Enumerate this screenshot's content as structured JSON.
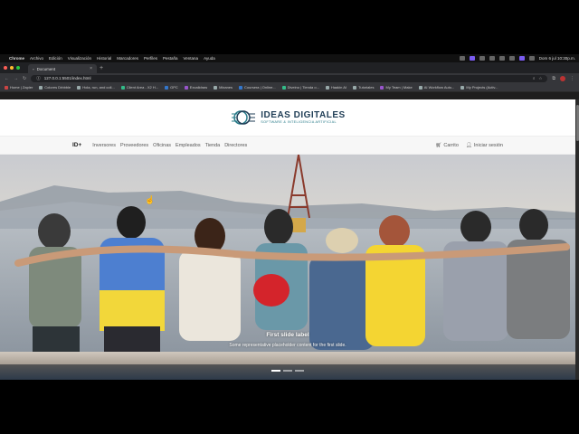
{
  "menubar": {
    "app": "Chrome",
    "items": [
      "Archivo",
      "Edición",
      "Visualización",
      "Historial",
      "Marcadores",
      "Perfiles",
      "Pestaña",
      "Ventana",
      "Ayuda"
    ],
    "clock": "Dom 6 jul 10:30p.m."
  },
  "browser": {
    "tab_title": "Document",
    "url": "127.0.0.1:5501/index.html",
    "bookmarks": [
      {
        "label": "Home | Zapier",
        "icon": "red"
      },
      {
        "label": "Colores Drbbble",
        "icon": "folder"
      },
      {
        "label": "Hola, run, and coll...",
        "icon": "folder"
      },
      {
        "label": "Client Area - X2 H...",
        "icon": "green"
      },
      {
        "label": "GPC",
        "icon": "blue"
      },
      {
        "label": "Excalidraw",
        "icon": "purple"
      },
      {
        "label": "Mixanes",
        "icon": "folder"
      },
      {
        "label": "Coursera | Online...",
        "icon": "blue"
      },
      {
        "label": "Diveino | Tienda o...",
        "icon": "green"
      },
      {
        "label": "Haakin AI",
        "icon": "folder"
      },
      {
        "label": "Tutoriales",
        "icon": "folder"
      },
      {
        "label": "My Team | Make",
        "icon": "purple"
      },
      {
        "label": "AI Workflow Auto...",
        "icon": "folder"
      },
      {
        "label": "My Projects (Activ...",
        "icon": "folder"
      }
    ]
  },
  "site": {
    "logo_title": "IDEAS DIGITALES",
    "logo_subtitle": "SOFTWARE & INTELIGENCIA ARTIFICIAL",
    "brand": "ID+",
    "nav": [
      "Inversores",
      "Proveedores",
      "Oficinas",
      "Empleados",
      "Tienda",
      "Directores"
    ],
    "cart": "Carrito",
    "login": "Iniciar sesión"
  },
  "carousel": {
    "slide_title": "First slide label",
    "slide_text": "Some representative placeholder content for the first slide.",
    "slides": 3,
    "active": 0
  }
}
